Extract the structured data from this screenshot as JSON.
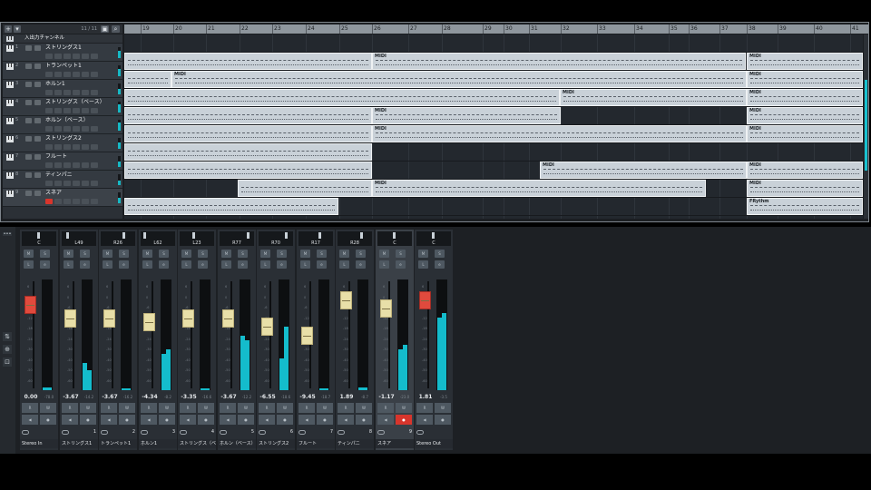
{
  "project": {
    "track_count": "11 / 11",
    "input_channel_label": "入出力チャンネル",
    "add_button": "+",
    "dropdown_button": "▾",
    "tracks": [
      {
        "num": "1",
        "name": "ストリングス1"
      },
      {
        "num": "2",
        "name": "トランペット1"
      },
      {
        "num": "3",
        "name": "ホルン1"
      },
      {
        "num": "4",
        "name": "ストリングス（ベース）"
      },
      {
        "num": "5",
        "name": "ホルン（ベース）"
      },
      {
        "num": "6",
        "name": "ストリングス2"
      },
      {
        "num": "7",
        "name": "フルート"
      },
      {
        "num": "8",
        "name": "ティンパニ"
      },
      {
        "num": "9",
        "name": "スネア"
      }
    ],
    "ruler": [
      "19",
      "20",
      "21",
      "22",
      "23",
      "24",
      "25",
      "26",
      "27",
      "28",
      "29",
      "30",
      "31",
      "32",
      "33",
      "34",
      "35",
      "36",
      "37",
      "38",
      "39",
      "40",
      "41"
    ],
    "event_label": "MIDI",
    "rhythm_label": "FRythm"
  },
  "mixer": {
    "channels": [
      {
        "pan": "C",
        "vol": "0.00",
        "peak": "-78.0",
        "num": "",
        "name": "Stereo In"
      },
      {
        "pan": "L49",
        "vol": "-3.67",
        "peak": "-14.2",
        "num": "1",
        "name": "ストリングス1"
      },
      {
        "pan": "R26",
        "vol": "-3.67",
        "peak": "-16.2",
        "num": "2",
        "name": "トランペット1"
      },
      {
        "pan": "L62",
        "vol": "-4.34",
        "peak": "-8.2",
        "num": "3",
        "name": "ホルン1"
      },
      {
        "pan": "L23",
        "vol": "-3.35",
        "peak": "-16.6",
        "num": "4",
        "name": "ストリングス（ベー"
      },
      {
        "pan": "R77",
        "vol": "-3.67",
        "peak": "-12.2",
        "num": "5",
        "name": "ホルン（ベース）"
      },
      {
        "pan": "R70",
        "vol": "-6.55",
        "peak": "-18.6",
        "num": "6",
        "name": "ストリングス2"
      },
      {
        "pan": "R17",
        "vol": "-9.45",
        "peak": "-18.7",
        "num": "7",
        "name": "フルート"
      },
      {
        "pan": "R28",
        "vol": "1.89",
        "peak": "-8.7",
        "num": "8",
        "name": "ティンパニ"
      },
      {
        "pan": "C",
        "vol": "-1.17",
        "peak": "-23.0",
        "num": "9",
        "name": "スネア"
      },
      {
        "pan": "C",
        "vol": "1.81",
        "peak": "-3.5",
        "num": "",
        "name": "Stereo Out"
      }
    ],
    "mute_label": "M",
    "solo_label": "S",
    "listen_label": "L",
    "edit_label": "e",
    "read_label": "R",
    "write_label": "W",
    "scale_marks": [
      "6",
      "0",
      "-6",
      "-12",
      "-18",
      "-24",
      "-30",
      "-40",
      "-50",
      "-60"
    ]
  },
  "colors": {
    "accent": "#18c2d0",
    "fader": "#e8dfa8",
    "master_fader": "#e04a3d",
    "record": "#d8352c"
  }
}
